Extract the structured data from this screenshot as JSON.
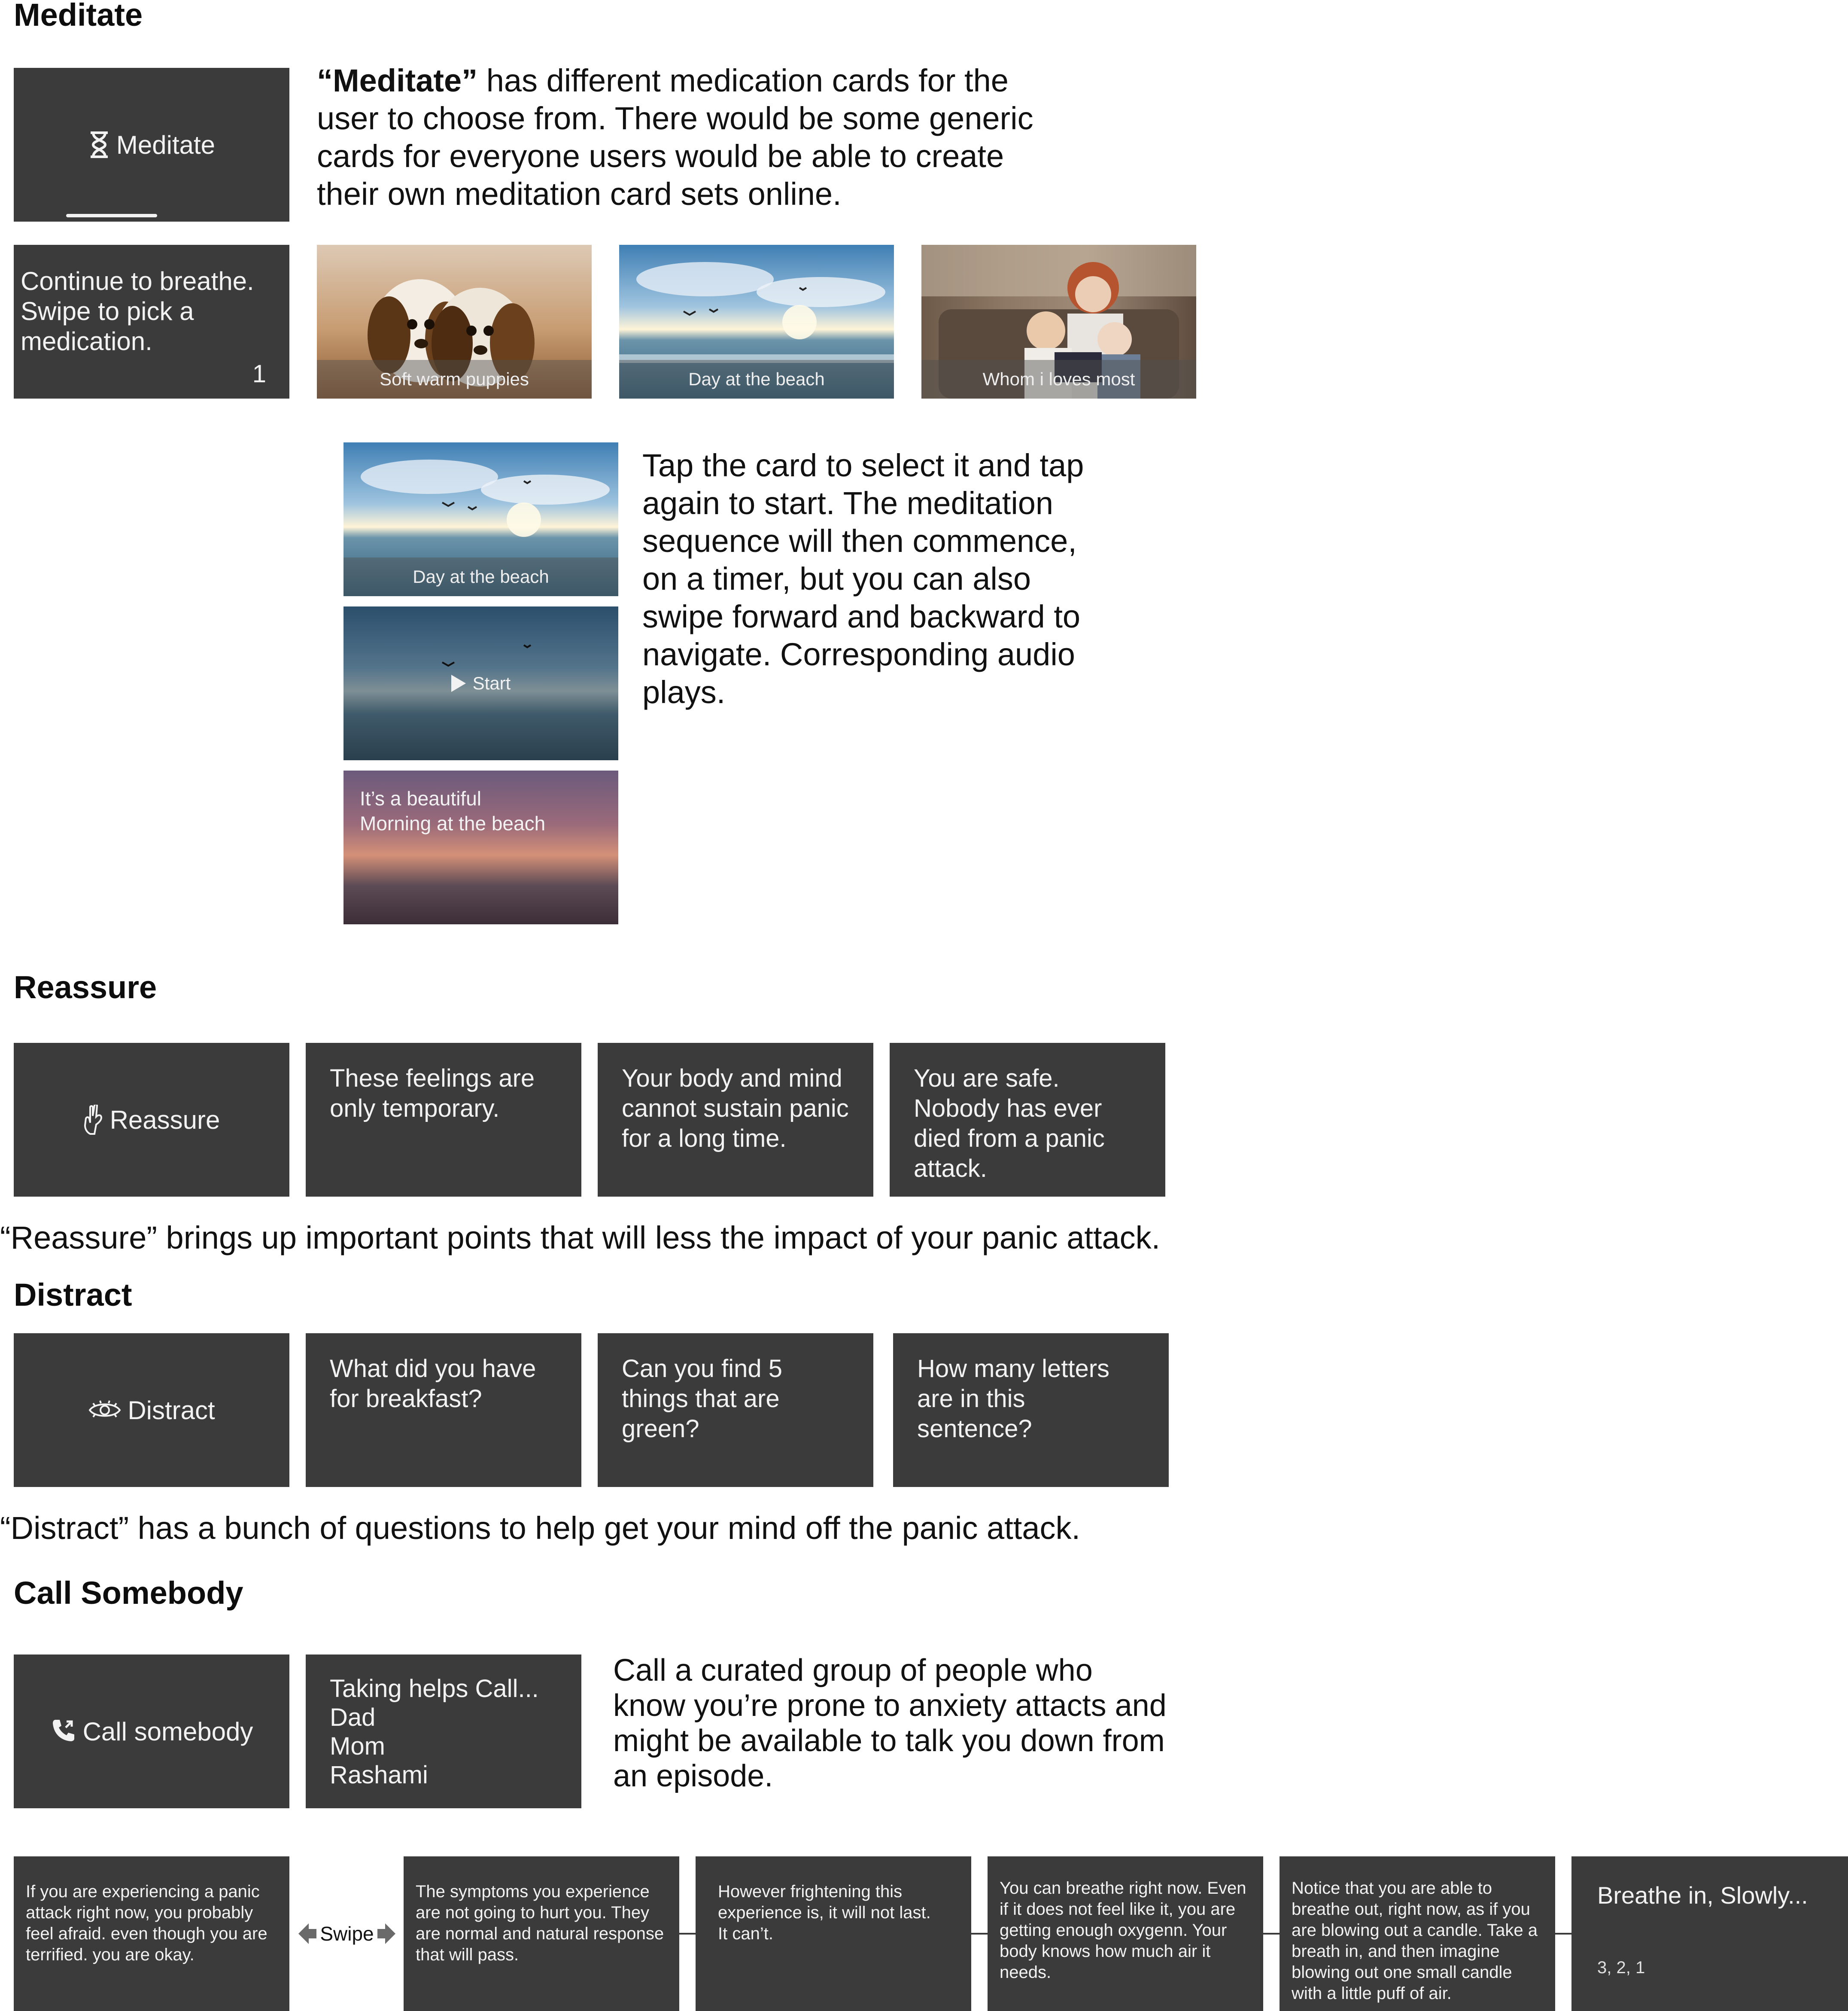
{
  "meditate": {
    "heading": "Meditate",
    "menu_label": "Meditate",
    "desc_bold": "“Meditate”",
    "desc_rest": " has different medication cards for the user to choose from. There would be some generic cards for everyone users would be able to create their own meditation card sets online.",
    "prompt_card": "Continue to breathe. Swipe to pick a medication.",
    "prompt_page": "1",
    "cards": [
      {
        "caption": "Soft warm puppies"
      },
      {
        "caption": "Day at the beach"
      },
      {
        "caption": "Whom i loves most"
      }
    ],
    "sequence": {
      "card1_caption": "Day at the beach",
      "card2_label": "Start",
      "card3_line1": "It’s a beautiful",
      "card3_line2": "Morning at the beach",
      "desc": "Tap the card to select it and tap again to start. The meditation sequence will then commence, on a timer, but you can also swipe forward and backward to navigate. Corresponding audio plays."
    }
  },
  "reassure": {
    "heading": "Reassure",
    "menu_label": "Reassure",
    "cards": [
      "These feelings are only temporary.",
      "Your body and mind cannot sustain panic for a long time.",
      "You are safe. Nobody has ever died from a panic attack."
    ],
    "desc": "“Reassure” brings up important points that will less the impact of your panic attack."
  },
  "distract": {
    "heading": "Distract",
    "menu_label": "Distract",
    "cards": [
      "What did you have for breakfast?",
      "Can you find 5 things that are green?",
      "How many letters are in this sentence?"
    ],
    "desc": "“Distract” has a bunch of questions to help get your mind off the panic attack."
  },
  "call": {
    "heading": "Call Somebody",
    "menu_label": "Call somebody",
    "list_title": "Taking helps Call...",
    "contacts": [
      "Dad",
      "Mom",
      "Rashami"
    ],
    "desc": "Call a curated group of people who know you’re prone to anxiety attacts and might be available to talk you down from an episode."
  },
  "panic_flow": {
    "swipe_label": "Swipe",
    "cards": [
      "If you are experiencing a panic attack right now, you probably feel afraid. even though you are terrified. you are okay.",
      "The symptoms you experience are not going to hurt you. They are normal and natural response that will pass.",
      "However frightening this experience is, it will not last. It can’t.",
      "You can breathe right now. Even if it does not feel like it, you are getting enough oxygenn. Your body knows how much air it needs.",
      "Notice that you are  able to breathe out, right now, as if you are blowing out a candle. Take a breath in, and then imagine blowing out one small candle with a little puff of air."
    ],
    "breathe_title": "Breathe in, Slowly...",
    "breathe_count": "3, 2, 1"
  },
  "colors": {
    "card": "#3b3b3b",
    "card_text": "#f2f2f2"
  }
}
